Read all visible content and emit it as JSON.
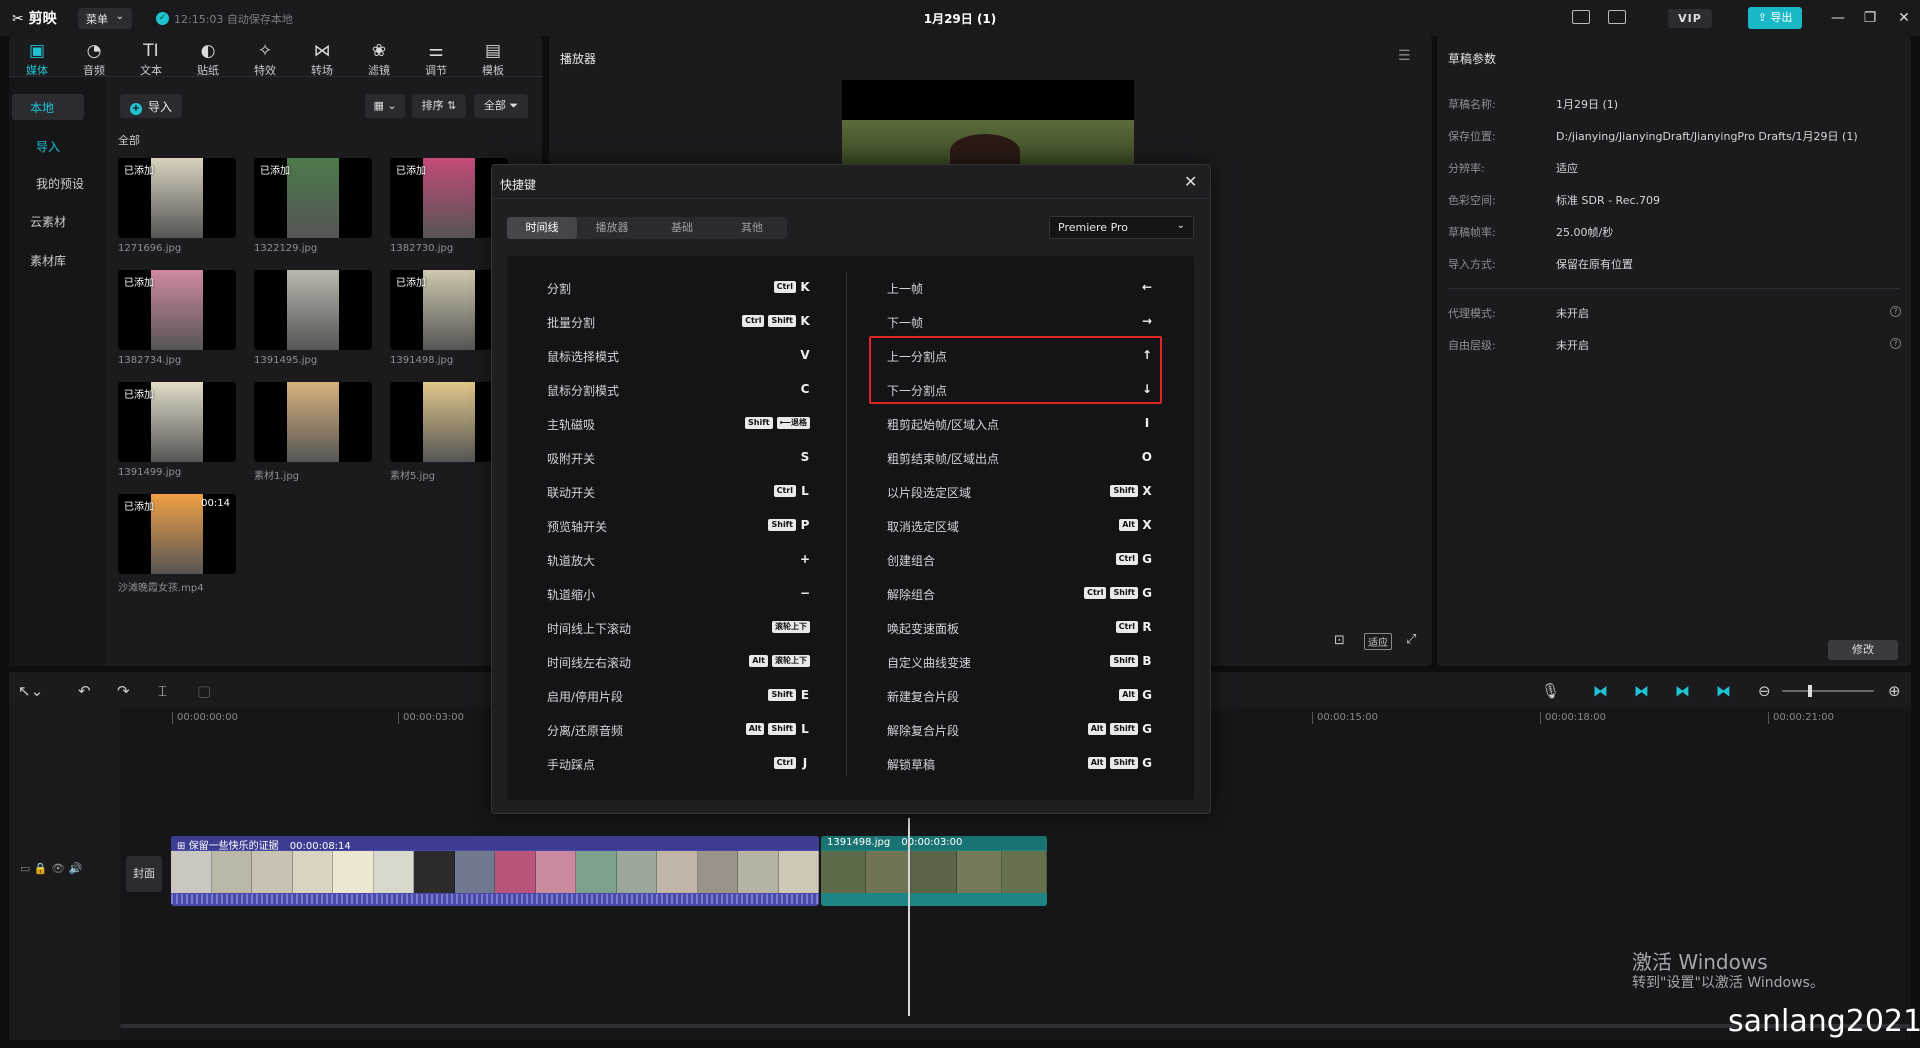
{
  "app": {
    "logo": "剪映",
    "menu_label": "菜单",
    "autosave_text": "12:15:03 自动保存本地",
    "title": "1月29日 (1)",
    "vip_label": "VIP",
    "export_label": "导出",
    "accent_color": "#1fc3d3"
  },
  "media_tabs": [
    {
      "label": "媒体",
      "icon": "media-icon",
      "glyph": "▣"
    },
    {
      "label": "音频",
      "icon": "audio-icon",
      "glyph": "◔"
    },
    {
      "label": "文本",
      "icon": "text-icon",
      "glyph": "TI"
    },
    {
      "label": "贴纸",
      "icon": "sticker-icon",
      "glyph": "◐"
    },
    {
      "label": "特效",
      "icon": "effects-icon",
      "glyph": "✧"
    },
    {
      "label": "转场",
      "icon": "transition-icon",
      "glyph": "⋈"
    },
    {
      "label": "滤镜",
      "icon": "filter-icon",
      "glyph": "❀"
    },
    {
      "label": "调节",
      "icon": "adjust-icon",
      "glyph": "⚌"
    },
    {
      "label": "模板",
      "icon": "template-icon",
      "glyph": "▤"
    }
  ],
  "sidebar": {
    "local": "本地",
    "import": "导入",
    "my_presets": "我的预设",
    "cloud": "云素材",
    "library": "素材库"
  },
  "media_toolbar": {
    "import": "导入",
    "sort": "排序",
    "all": "全部",
    "section_all": "全部"
  },
  "media_items": [
    {
      "name": "1271696.jpg",
      "added": "已添加",
      "duration": ""
    },
    {
      "name": "1322129.jpg",
      "added": "已添加",
      "duration": ""
    },
    {
      "name": "1382730.jpg",
      "added": "已添加",
      "duration": ""
    },
    {
      "name": "1382734.jpg",
      "added": "已添加",
      "duration": ""
    },
    {
      "name": "1391495.jpg",
      "added": "",
      "duration": ""
    },
    {
      "name": "1391498.jpg",
      "added": "已添加",
      "duration": ""
    },
    {
      "name": "1391499.jpg",
      "added": "已添加",
      "duration": ""
    },
    {
      "name": "素材1.jpg",
      "added": "",
      "duration": ""
    },
    {
      "name": "素材5.jpg",
      "added": "",
      "duration": ""
    },
    {
      "name": "沙滩晚霞女孩.mp4",
      "added": "已添加",
      "duration": "00:14"
    }
  ],
  "player": {
    "title": "播放器",
    "fit_label": "适应"
  },
  "params": {
    "title": "草稿参数",
    "rows": [
      {
        "key": "草稿名称:",
        "value": "1月29日 (1)"
      },
      {
        "key": "保存位置:",
        "value": "D:/jianying/JianyingDraft/JianyingPro Drafts/1月29日 (1)"
      },
      {
        "key": "分辨率:",
        "value": "适应"
      },
      {
        "key": "色彩空间:",
        "value": "标准 SDR - Rec.709"
      },
      {
        "key": "草稿帧率:",
        "value": "25.00帧/秒"
      },
      {
        "key": "导入方式:",
        "value": "保留在原有位置"
      }
    ],
    "rows2": [
      {
        "key": "代理模式:",
        "value": "未开启"
      },
      {
        "key": "自由层级:",
        "value": "未开启"
      }
    ],
    "modify": "修改"
  },
  "timeline": {
    "ticks": [
      "00:00:00:00",
      "00:00:03:00",
      "00:00:15:00",
      "00:00:18:00",
      "00:00:21:00"
    ],
    "cover_label": "封面",
    "clip1_title": "保留一些快乐的证据",
    "clip1_duration": "00:00:08:14",
    "clip2_title": "1391498.jpg",
    "clip2_duration": "00:00:03:00"
  },
  "dialog": {
    "title": "快捷键",
    "tabs": [
      "时间线",
      "播放器",
      "基础",
      "其他"
    ],
    "preset": "Premiere Pro",
    "left": [
      {
        "name": "分割",
        "mods": [
          "Ctrl"
        ],
        "key": "K"
      },
      {
        "name": "批量分割",
        "mods": [
          "Ctrl",
          "Shift"
        ],
        "key": "K"
      },
      {
        "name": "鼠标选择模式",
        "mods": [],
        "key": "V"
      },
      {
        "name": "鼠标分割模式",
        "mods": [],
        "key": "C"
      },
      {
        "name": "主轨磁吸",
        "mods": [
          "Shift",
          "⟵退格"
        ],
        "key": ""
      },
      {
        "name": "吸附开关",
        "mods": [],
        "key": "S"
      },
      {
        "name": "联动开关",
        "mods": [
          "Ctrl"
        ],
        "key": "L"
      },
      {
        "name": "预览轴开关",
        "mods": [
          "Shift"
        ],
        "key": "P"
      },
      {
        "name": "轨道放大",
        "mods": [],
        "key": "+"
      },
      {
        "name": "轨道缩小",
        "mods": [],
        "key": "−"
      },
      {
        "name": "时间线上下滚动",
        "mods": [
          "滚轮上下"
        ],
        "key": ""
      },
      {
        "name": "时间线左右滚动",
        "mods": [
          "Alt",
          "滚轮上下"
        ],
        "key": ""
      },
      {
        "name": "启用/停用片段",
        "mods": [
          "Shift"
        ],
        "key": "E"
      },
      {
        "name": "分离/还原音频",
        "mods": [
          "Alt",
          "Shift"
        ],
        "key": "L"
      },
      {
        "name": "手动踩点",
        "mods": [
          "Ctrl"
        ],
        "key": "J"
      }
    ],
    "right": [
      {
        "name": "上一帧",
        "mods": [],
        "key": "←"
      },
      {
        "name": "下一帧",
        "mods": [],
        "key": "→"
      },
      {
        "name": "上一分割点",
        "mods": [],
        "key": "↑"
      },
      {
        "name": "下一分割点",
        "mods": [],
        "key": "↓"
      },
      {
        "name": "粗剪起始帧/区域入点",
        "mods": [],
        "key": "I"
      },
      {
        "name": "粗剪结束帧/区域出点",
        "mods": [],
        "key": "O"
      },
      {
        "name": "以片段选定区域",
        "mods": [
          "Shift"
        ],
        "key": "X"
      },
      {
        "name": "取消选定区域",
        "mods": [
          "Alt"
        ],
        "key": "X"
      },
      {
        "name": "创建组合",
        "mods": [
          "Ctrl"
        ],
        "key": "G"
      },
      {
        "name": "解除组合",
        "mods": [
          "Ctrl",
          "Shift"
        ],
        "key": "G"
      },
      {
        "name": "唤起变速面板",
        "mods": [
          "Ctrl"
        ],
        "key": "R"
      },
      {
        "name": "自定义曲线变速",
        "mods": [
          "Shift"
        ],
        "key": "B"
      },
      {
        "name": "新建复合片段",
        "mods": [
          "Alt"
        ],
        "key": "G"
      },
      {
        "name": "解除复合片段",
        "mods": [
          "Alt",
          "Shift"
        ],
        "key": "G"
      },
      {
        "name": "解锁草稿",
        "mods": [
          "Alt",
          "Shift"
        ],
        "key": "G"
      }
    ]
  },
  "overlay": {
    "activate_title": "激活 Windows",
    "activate_sub": "转到\"设置\"以激活 Windows。",
    "watermark": "sanlang2021"
  }
}
